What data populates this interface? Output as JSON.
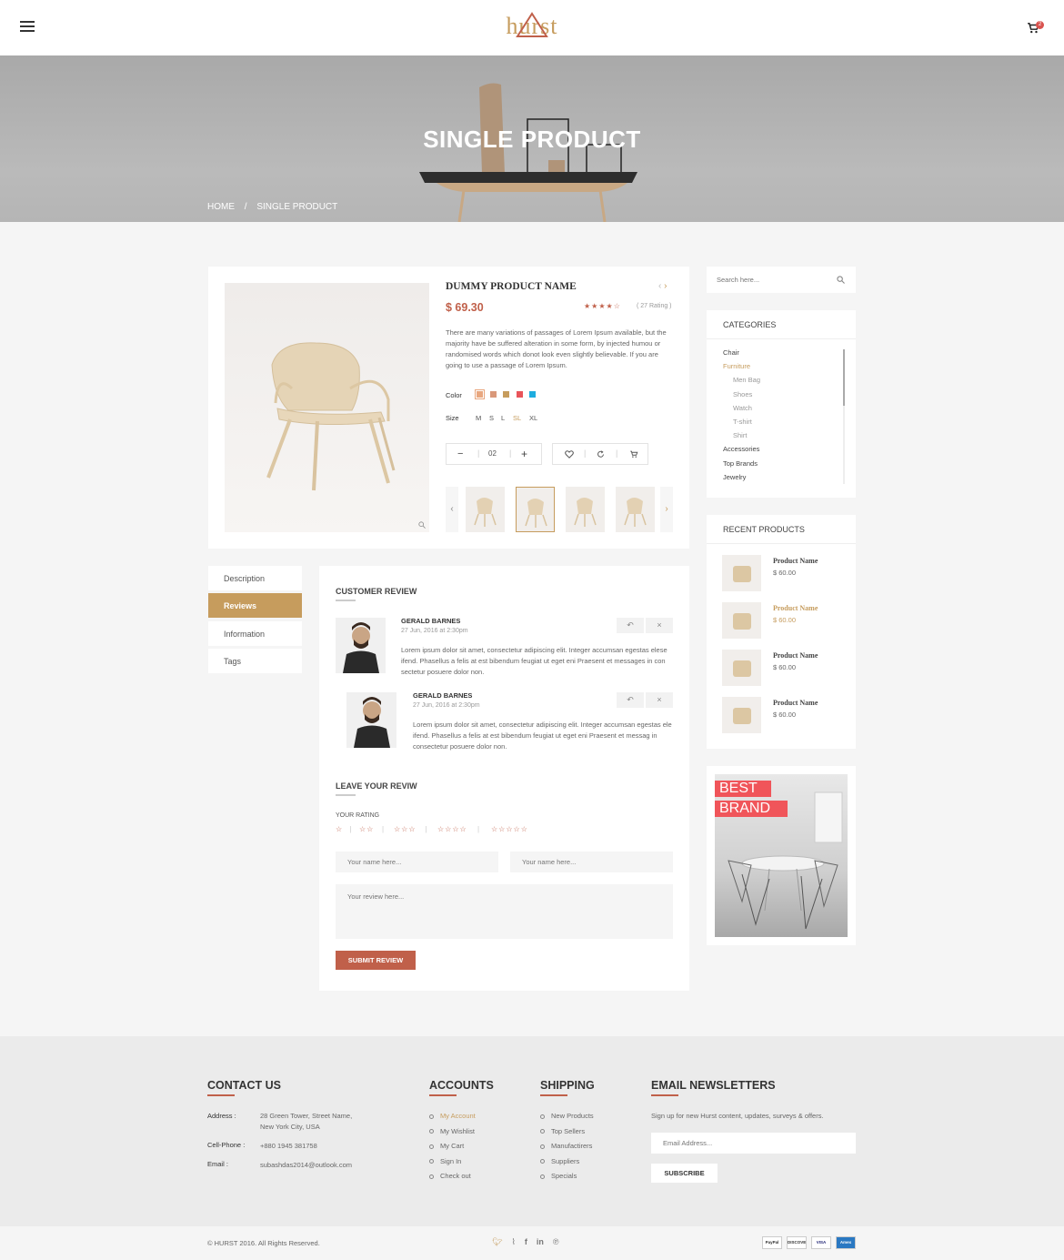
{
  "header": {
    "logo": "hurst",
    "cart_count": "2"
  },
  "banner": {
    "title": "SINGLE PRODUCT",
    "breadcrumb": [
      "HOME",
      "/",
      "SINGLE PRODUCT"
    ]
  },
  "product": {
    "name": "DUMMY PRODUCT NAME",
    "price": "$ 69.30",
    "rating_count": "( 27 Rating )",
    "rating": 3.5,
    "description": "There are many variations of passages of Lorem Ipsum available, but the majority have be suffered alteration in some form, by injected humou or randomised words which donot look even slightly believable. If you are going to use a passage of Lorem Ipsum.",
    "color_label": "Color",
    "colors": [
      "#e8a77f",
      "#d9987a",
      "#c69c5d",
      "#e8545a",
      "#1eaddf"
    ],
    "size_label": "Size",
    "sizes": [
      "M",
      "S",
      "L",
      "SL",
      "XL"
    ],
    "selected_size": "SL",
    "quantity": "02",
    "minus": "−",
    "plus": "+"
  },
  "tabs": [
    "Description",
    "Reviews",
    "Information",
    "Tags"
  ],
  "reviews": {
    "title": "CUSTOMER REVIEW",
    "items": [
      {
        "name": "GERALD BARNES",
        "date": "27 Jun, 2016 at 2:30pm",
        "text": "Lorem ipsum dolor sit amet, consectetur adipiscing elit. Integer accumsan egestas elese ifend. Phasellus a felis at est bibendum feugiat ut eget eni Praesent et messages in con sectetur posuere dolor non."
      },
      {
        "name": "GERALD BARNES",
        "date": "27 Jun, 2016 at 2:30pm",
        "text": "Lorem ipsum dolor sit amet, consectetur adipiscing elit. Integer accumsan egestas ele ifend. Phasellus a felis at est bibendum feugiat ut eget eni Praesent et messag in consectetur posuere dolor non."
      }
    ],
    "leave_title": "LEAVE YOUR REVIW",
    "your_rating": "YOUR RATING",
    "name_placeholder": "Your name here...",
    "name2_placeholder": "Your name here...",
    "review_placeholder": "Your review here...",
    "submit": "SUBMIT REVIEW"
  },
  "sidebar": {
    "search_placeholder": "Search here...",
    "categories_title": "CATEGORIES",
    "categories": [
      {
        "label": "Chair",
        "level": 0
      },
      {
        "label": "Furniture",
        "level": 0,
        "active": true
      },
      {
        "label": "Men Bag",
        "level": 1
      },
      {
        "label": "Shoes",
        "level": 1
      },
      {
        "label": "Watch",
        "level": 1
      },
      {
        "label": "T-shirt",
        "level": 1
      },
      {
        "label": "Shirt",
        "level": 1
      },
      {
        "label": "Accessories",
        "level": 0
      },
      {
        "label": "Top Brands",
        "level": 0
      },
      {
        "label": "Jewelry",
        "level": 0
      }
    ],
    "recent_title": "RECENT PRODUCTS",
    "recent": [
      {
        "name": "Product Name",
        "price": "$ 60.00"
      },
      {
        "name": "Product Name",
        "price": "$ 60.00",
        "active": true
      },
      {
        "name": "Product Name",
        "price": "$ 60.00"
      },
      {
        "name": "Product Name",
        "price": "$ 60.00"
      }
    ],
    "ad_line1": "BEST",
    "ad_line2": "BRAND"
  },
  "footer": {
    "contact_title": "CONTACT US",
    "address_label": "Address :",
    "address": "28 Green Tower, Street Name,",
    "address2": "New York City, USA",
    "phone_label": "Cell-Phone :",
    "phone": "+880 1945 381758",
    "email_label": "Email :",
    "email": "subashdas2014@outlook.com",
    "accounts_title": "ACCOUNTS",
    "accounts": [
      "My Account",
      "My Wishlist",
      "My Cart",
      "Sign In",
      "Check out"
    ],
    "shipping_title": "SHIPPING",
    "shipping": [
      "New Products",
      "Top Sellers",
      "Manufactirers",
      "Suppliers",
      "Specials"
    ],
    "newsletter_title": "EMAIL NEWSLETTERS",
    "newsletter_text": "Sign up for new Hurst content, updates, surveys & offers.",
    "email_placeholder": "Email Address...",
    "subscribe": "SUBSCRIBE",
    "copyright": "© HURST 2016. All Rights Reserved.",
    "payments": [
      "PayPal",
      "DISCOVER",
      "VISA",
      "Amex"
    ]
  },
  "colors": {
    "accent": "#c69c5d",
    "price": "#c0604a",
    "button": "#c0604a"
  }
}
